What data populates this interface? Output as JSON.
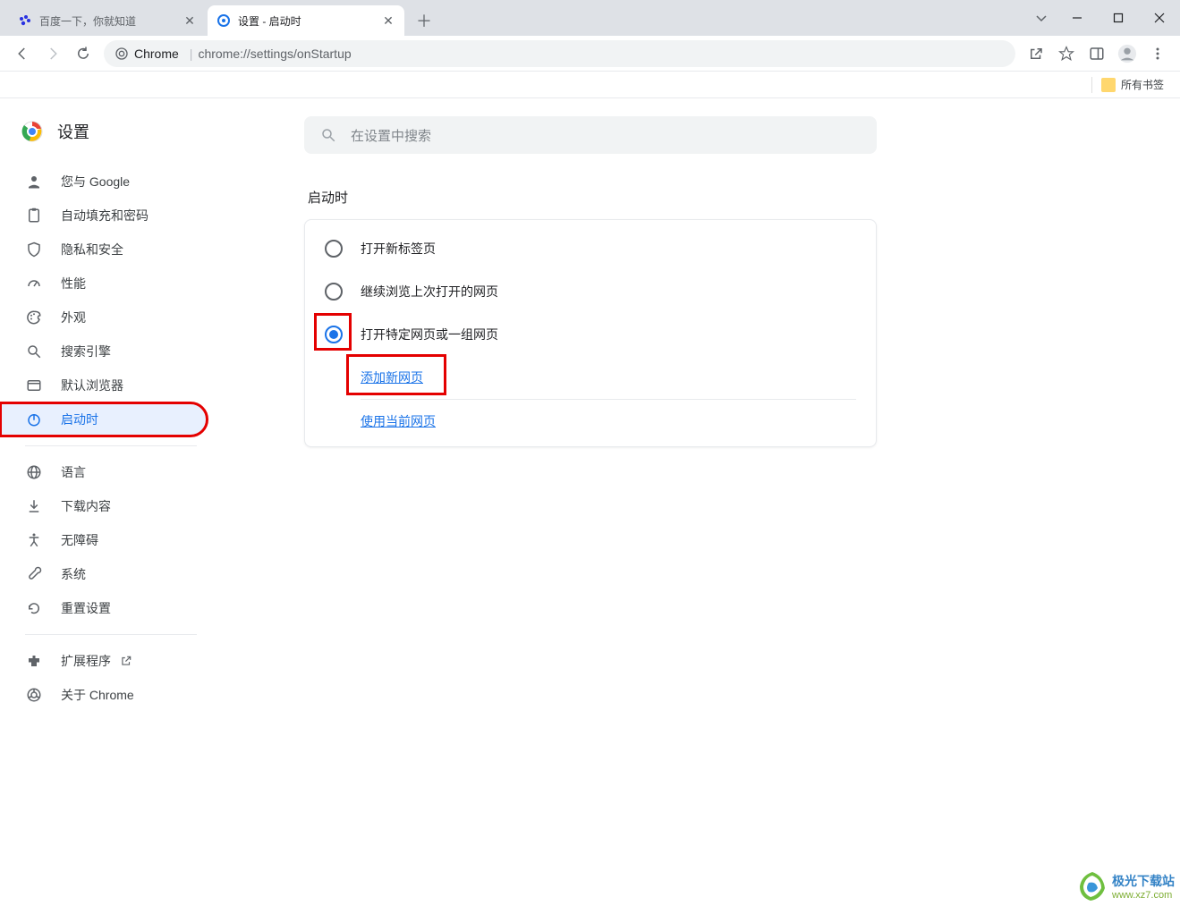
{
  "tabs": [
    {
      "title": "百度一下，你就知道",
      "active": false
    },
    {
      "title": "设置 - 启动时",
      "active": true
    }
  ],
  "url": {
    "prefix": "Chrome",
    "path": "chrome://settings/onStartup"
  },
  "bookmarks_bar": {
    "all_bookmarks": "所有书签"
  },
  "sidebar": {
    "title": "设置",
    "items": [
      {
        "label": "您与 Google",
        "icon": "person"
      },
      {
        "label": "自动填充和密码",
        "icon": "autofill"
      },
      {
        "label": "隐私和安全",
        "icon": "shield"
      },
      {
        "label": "性能",
        "icon": "speed"
      },
      {
        "label": "外观",
        "icon": "palette"
      },
      {
        "label": "搜索引擎",
        "icon": "search"
      },
      {
        "label": "默认浏览器",
        "icon": "browser"
      },
      {
        "label": "启动时",
        "icon": "power",
        "active": true
      }
    ],
    "items2": [
      {
        "label": "语言",
        "icon": "globe"
      },
      {
        "label": "下载内容",
        "icon": "download"
      },
      {
        "label": "无障碍",
        "icon": "accessibility"
      },
      {
        "label": "系统",
        "icon": "wrench"
      },
      {
        "label": "重置设置",
        "icon": "restore"
      }
    ],
    "items3": [
      {
        "label": "扩展程序",
        "icon": "extension",
        "external": true
      },
      {
        "label": "关于 Chrome",
        "icon": "chrome"
      }
    ]
  },
  "search_placeholder": "在设置中搜索",
  "section_title": "启动时",
  "options": {
    "new_tab": "打开新标签页",
    "continue": "继续浏览上次打开的网页",
    "specific": "打开特定网页或一组网页"
  },
  "links": {
    "add_page": "添加新网页",
    "use_current": "使用当前网页"
  },
  "watermark": {
    "text": "极光下载站",
    "sub": "www.xz7.com"
  }
}
